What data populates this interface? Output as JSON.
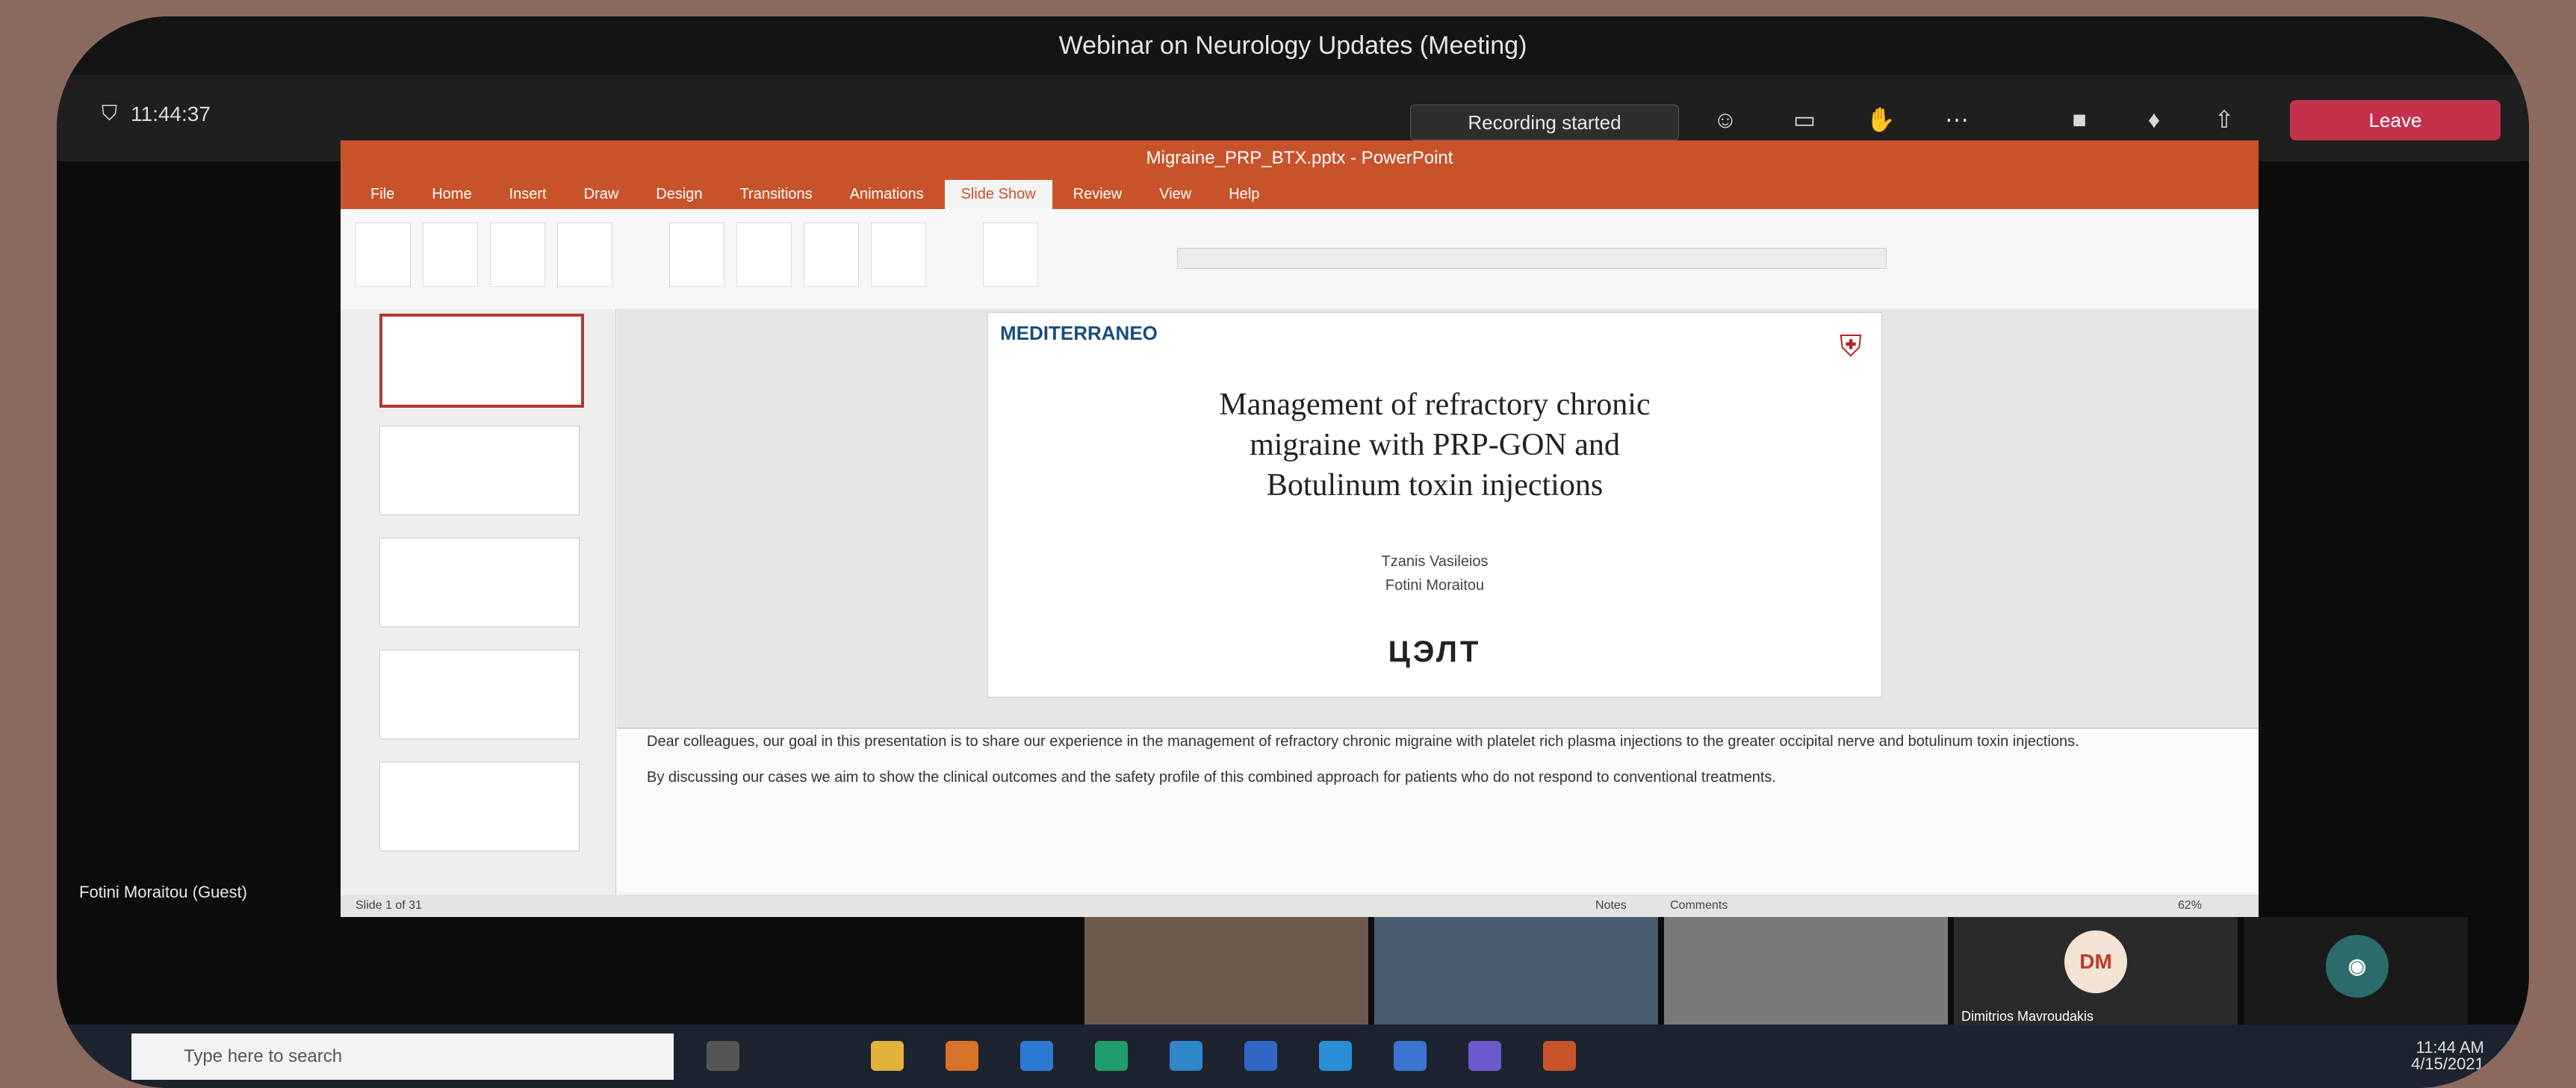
{
  "window": {
    "title": "Webinar on Neurology Updates (Meeting)"
  },
  "meeting_toolbar": {
    "timer": "11:44:37",
    "recording_label": "Recording started",
    "icons": [
      "people-icon",
      "chat-icon",
      "raise-hand-icon",
      "more-icon",
      "camera-icon",
      "mic-icon",
      "share-icon"
    ],
    "leave_label": "Leave"
  },
  "powerpoint": {
    "title": "Migraine_PRP_BTX.pptx - PowerPoint",
    "tabs": [
      "File",
      "Home",
      "Insert",
      "Draw",
      "Design",
      "Transitions",
      "Animations",
      "Slide Show",
      "Review",
      "View",
      "Help"
    ],
    "active_tab": "Slide Show",
    "status": {
      "slide_counter": "Slide 1 of 31",
      "notes": "Notes",
      "comments": "Comments",
      "zoom": "62%"
    }
  },
  "slide": {
    "logo": "MEDITERRANEO",
    "title_lines": [
      "Management of refractory chronic",
      "migraine with PRP-GON and",
      "Botulinum toxin injections"
    ],
    "authors": [
      "Tzanis Vasileios",
      "Fotini Moraitou"
    ],
    "brand": "ЦЭЛТ"
  },
  "notes": [
    "Dear colleagues, our goal in this presentation is to share our experience in the management of refractory chronic migraine with platelet rich plasma injections to the greater occipital nerve and botulinum toxin injections.",
    "By discussing our cases we aim to show the clinical outcomes and the safety profile of this combined approach for patients who do not respond to conventional treatments."
  ],
  "speaker_label": "Fotini Moraitou (Guest)",
  "participants": [
    {
      "name": ""
    },
    {
      "name": ""
    },
    {
      "name": ""
    },
    {
      "name": "Dimitrios Mavroudakis",
      "initials": "DM"
    },
    {
      "name": ""
    }
  ],
  "taskbar": {
    "search_placeholder": "Type here to search",
    "time": "11:44 AM",
    "date": "4/15/2021"
  },
  "colors": {
    "accent": "#c8532b",
    "leave": "#c4314b",
    "background": "#8a6a5e"
  }
}
